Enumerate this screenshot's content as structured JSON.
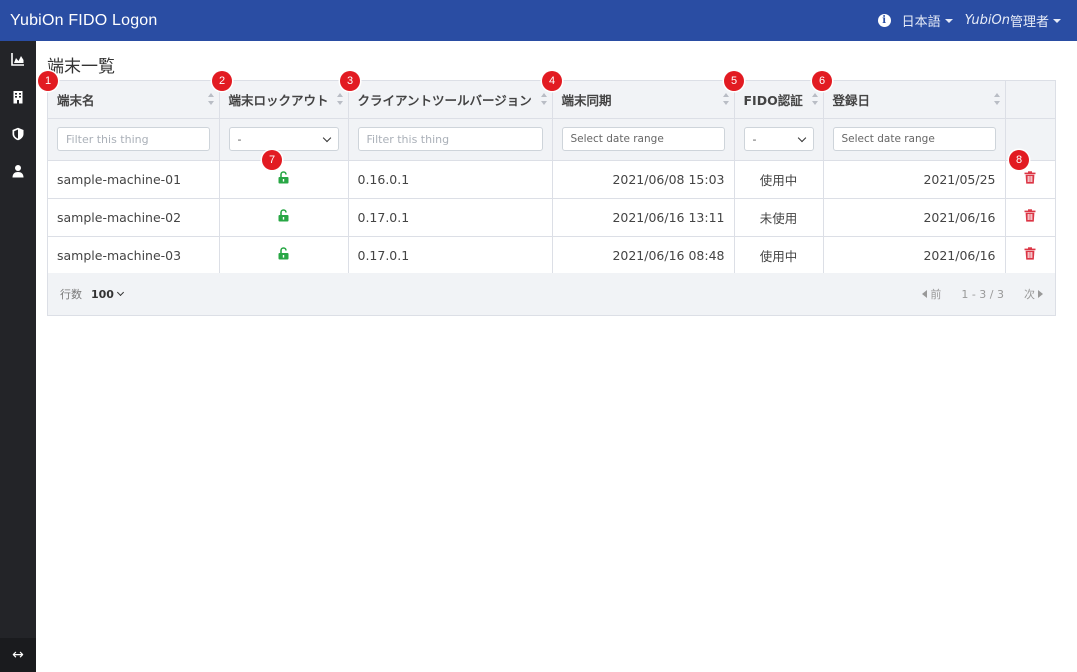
{
  "app": {
    "title": "YubiOn FIDO Logon"
  },
  "topbar": {
    "language": "日本語",
    "admin_brand": "YubiOn",
    "admin_suffix": "管理者"
  },
  "sidebar": {
    "items": [
      {
        "icon": "chart-area-icon"
      },
      {
        "icon": "building-icon"
      },
      {
        "icon": "shield-icon"
      },
      {
        "icon": "user-icon"
      }
    ],
    "toggle_glyph": "↔"
  },
  "page": {
    "title": "端末一覧"
  },
  "table": {
    "columns": [
      {
        "label": "端末名",
        "filter": "text",
        "placeholder": "Filter this thing"
      },
      {
        "label": "端末ロックアウト",
        "filter": "select",
        "selected": "-"
      },
      {
        "label": "クライアントツールバージョン",
        "filter": "text",
        "placeholder": "Filter this thing"
      },
      {
        "label": "端末同期",
        "filter": "date",
        "placeholder": "Select date range"
      },
      {
        "label": "FIDO認証",
        "filter": "select",
        "selected": "-"
      },
      {
        "label": "登録日",
        "filter": "date",
        "placeholder": "Select date range"
      }
    ],
    "rows": [
      {
        "name": "sample-machine-01",
        "lock": "unlock-icon",
        "version": "0.16.0.1",
        "sync": "2021/06/08 15:03",
        "fido": "使用中",
        "registered": "2021/05/25"
      },
      {
        "name": "sample-machine-02",
        "lock": "unlock-icon",
        "version": "0.17.0.1",
        "sync": "2021/06/16 13:11",
        "fido": "未使用",
        "registered": "2021/06/16"
      },
      {
        "name": "sample-machine-03",
        "lock": "unlock-icon",
        "version": "0.17.0.1",
        "sync": "2021/06/16 08:48",
        "fido": "使用中",
        "registered": "2021/06/16"
      }
    ]
  },
  "footer": {
    "rows_label": "行数",
    "rows_value": "100",
    "prev_label": "前",
    "range": "1 - 3 / 3",
    "next_label": "次"
  },
  "annotations": [
    "1",
    "2",
    "3",
    "4",
    "5",
    "6",
    "7",
    "8"
  ],
  "colors": {
    "topbar": "#2a4da3",
    "sidebar": "#232428",
    "unlock": "#28a745",
    "trash": "#dc3545",
    "badge": "#e21b22"
  }
}
